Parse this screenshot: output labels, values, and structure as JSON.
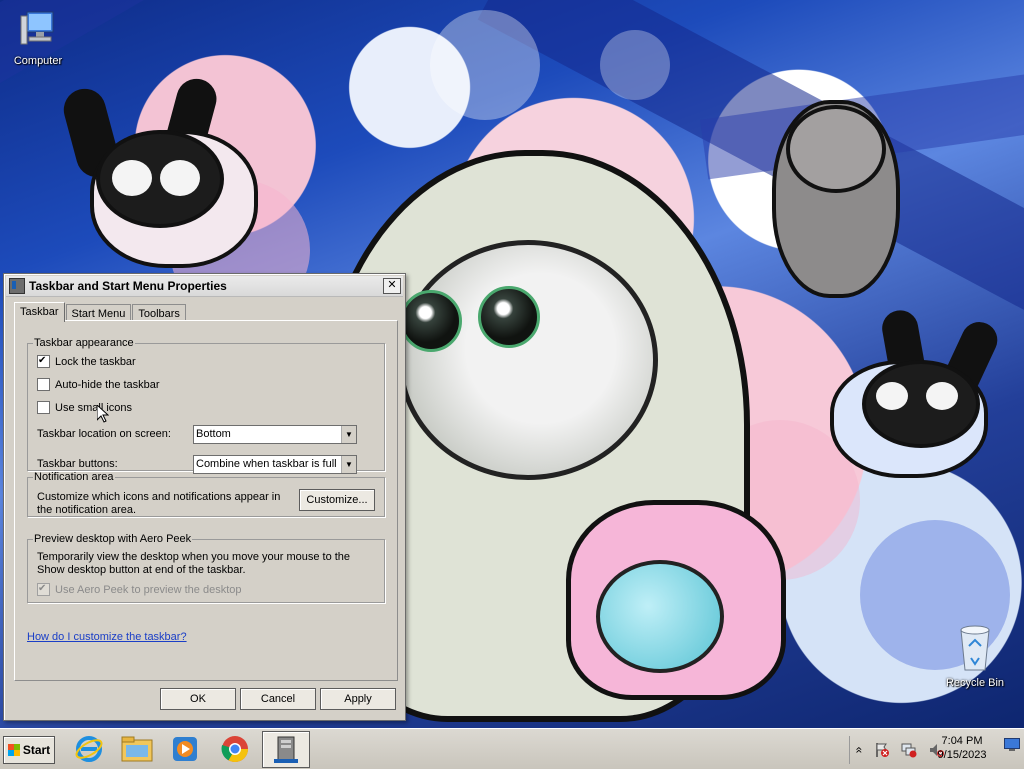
{
  "desktop": {
    "icons": [
      {
        "label": "Computer",
        "icon": "computer-icon"
      },
      {
        "label": "Recycle Bin",
        "icon": "recycle-bin-icon"
      }
    ]
  },
  "dialog": {
    "title": "Taskbar and Start Menu Properties",
    "close_glyph": "✕",
    "tabs": [
      {
        "label": "Taskbar",
        "active": true
      },
      {
        "label": "Start Menu",
        "active": false
      },
      {
        "label": "Toolbars",
        "active": false
      }
    ],
    "appearance": {
      "legend": "Taskbar appearance",
      "lock_label": "Lock the taskbar",
      "lock_checked": true,
      "autohide_label": "Auto-hide the taskbar",
      "autohide_checked": false,
      "small_icons_label": "Use small icons",
      "small_icons_checked": false,
      "location_label": "Taskbar location on screen:",
      "location_value": "Bottom",
      "buttons_label": "Taskbar buttons:",
      "buttons_value": "Combine when taskbar is full"
    },
    "notification": {
      "legend": "Notification area",
      "text": "Customize which icons and notifications appear in the notification area.",
      "button": "Customize..."
    },
    "aero_peek": {
      "legend": "Preview desktop with Aero Peek",
      "text": "Temporarily view the desktop when you move your mouse to the Show desktop button at end of the taskbar.",
      "checkbox_label": "Use Aero Peek to preview the desktop",
      "checked": true,
      "disabled": true
    },
    "help_link": "How do I customize the taskbar?",
    "buttons": {
      "ok": "OK",
      "cancel": "Cancel",
      "apply": "Apply"
    }
  },
  "taskbar": {
    "start_label": "Start",
    "pinned": [
      {
        "name": "internet-explorer-icon"
      },
      {
        "name": "file-explorer-icon"
      },
      {
        "name": "media-player-icon"
      },
      {
        "name": "chrome-icon"
      },
      {
        "name": "taskbar-properties-icon",
        "active": true
      }
    ],
    "tray_expand_glyph": "«",
    "clock_time": "7:04 PM",
    "clock_date": "9/15/2023"
  },
  "colors": {
    "dialog_bg": "#d4d0c8",
    "link": "#1a3ec7",
    "wallpaper_blue": "#1d4bbb",
    "wallpaper_pink": "#f6d2de"
  }
}
